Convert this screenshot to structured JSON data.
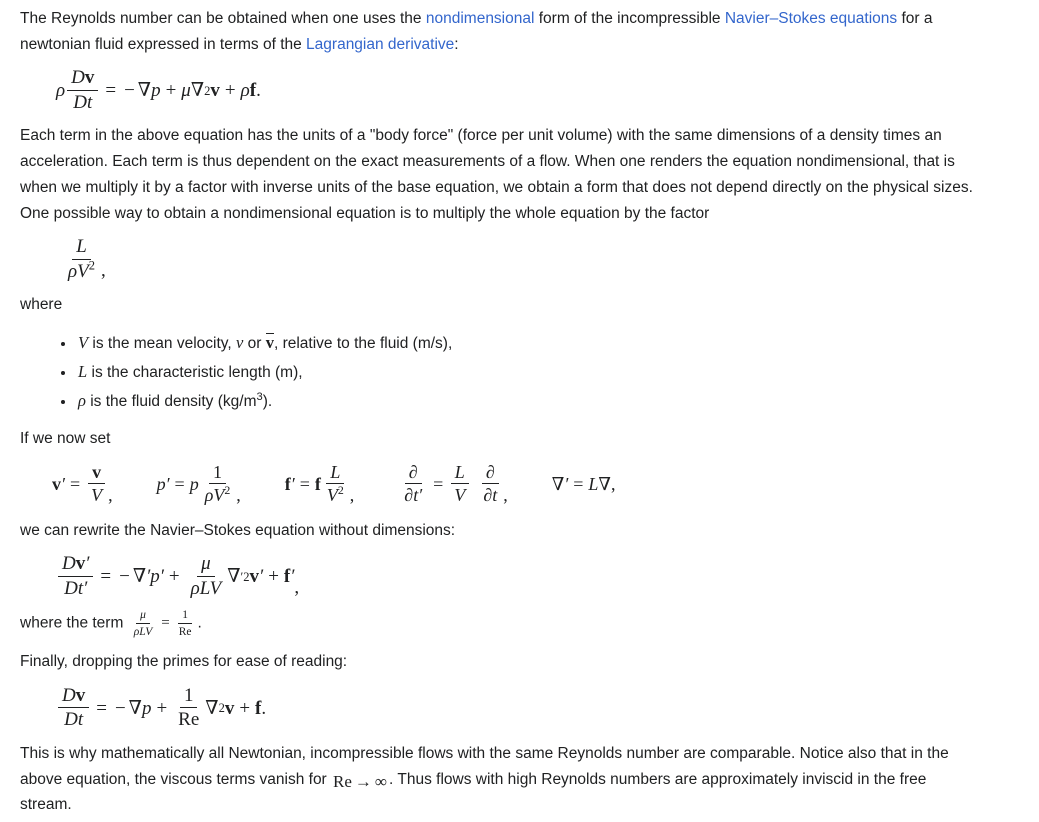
{
  "paragraphs": {
    "intro": {
      "seg1": "The Reynolds number can be obtained when one uses the ",
      "link1": "nondimensional",
      "seg2": " form of the incompressible ",
      "link2": "Navier–Stokes equations",
      "seg3": " for a newtonian fluid expressed in terms of the ",
      "link3": "Lagrangian derivative",
      "seg4": ":"
    },
    "units": "Each term in the above equation has the units of a \"body force\" (force per unit volume) with the same dimensions of a density times an acceleration. Each term is thus dependent on the exact measurements of a flow. When one renders the equation nondimensional, that is when we multiply it by a factor with inverse units of the base equation, we obtain a form that does not depend directly on the physical sizes. One possible way to obtain a nondimensional equation is to multiply the whole equation by the factor",
    "where": "where",
    "if_we_now_set": "If we now set",
    "rewrite": "we can rewrite the Navier–Stokes equation without dimensions:",
    "where_term_prefix": "where the term ",
    "where_term_suffix": ".",
    "finally": "Finally, dropping the primes for ease of reading:",
    "closing_seg1": "This is why mathematically all Newtonian, incompressible flows with the same Reynolds number are comparable. Notice also that in the above equation, the viscous terms vanish for ",
    "closing_seg2": ". Thus flows with high Reynolds numbers are approximately inviscid in the free stream."
  },
  "equations": {
    "navier_stokes": {
      "label": "ρ Dv/Dt = −∇p + μ∇²v + ρf.",
      "rho": "ρ",
      "num": "D",
      "num_bold": "v",
      "den": "D",
      "den_var": "t",
      "equals": "=",
      "minus": "−",
      "nabla": "∇",
      "p": "p",
      "plus": "+",
      "mu": "μ",
      "exp2": "2",
      "v_bold": "v",
      "rho2": "ρ",
      "f_bold": "f",
      "period": "."
    },
    "factor": {
      "label": "L / ρV²,",
      "num": "L",
      "den_rho": "ρ",
      "den_V": "V",
      "den_exp": "2",
      "comma": ","
    },
    "substitutions": {
      "label": "v′ = v/V, p′ = p·1/ρV², f′ = f·L/V², ∂/∂t′ = (L/V)(∂/∂t), ∇′ = L∇,",
      "s1": {
        "lhs_bold": "v",
        "prime": "′",
        "equals": "=",
        "num_bold": "v",
        "den": "V",
        "comma": ","
      },
      "s2": {
        "lhs": "p",
        "prime": "′",
        "equals": "=",
        "factor": "p",
        "num": "1",
        "den_rho": "ρ",
        "den_V": "V",
        "den_exp": "2",
        "comma": ","
      },
      "s3": {
        "lhs_bold": "f",
        "prime": "′",
        "equals": "=",
        "factor_bold": "f",
        "num": "L",
        "den": "V",
        "den_exp": "2",
        "comma": ","
      },
      "s4": {
        "num": "∂",
        "den_partial": "∂",
        "den_t": "t",
        "den_prime": "′",
        "equals": "=",
        "fnum": "L",
        "fden": "V",
        "pnum": "∂",
        "pden_partial": "∂",
        "pden_t": "t",
        "comma": ","
      },
      "s5": {
        "nabla": "∇",
        "prime": "′",
        "equals": "=",
        "L": "L",
        "nabla2": "∇",
        "comma": ","
      }
    },
    "nondim": {
      "label": "Dv′/Dt′ = −∇′p′ + μ/(ρLV) ∇′²v′ + f′,",
      "num_D": "D",
      "num_v": "v",
      "num_prime": "′",
      "den_D": "D",
      "den_t": "t",
      "den_prime": "′",
      "equals": "=",
      "minus": "−",
      "nabla": "∇",
      "nabla_prime": "′",
      "p": "p",
      "p_prime": "′",
      "plus": "+",
      "mu": "μ",
      "rho": "ρ",
      "L": "L",
      "V": "V",
      "nabla2": "∇",
      "nabla2_prime": "′",
      "exp2": "2",
      "v_bold": "v",
      "v_prime": "′",
      "f_bold": "f",
      "f_prime": "′",
      "comma": ","
    },
    "reynolds_term": {
      "label": "μ/ρLV = 1/Re",
      "mu": "μ",
      "rho": "ρ",
      "L": "L",
      "V": "V",
      "equals": "=",
      "one": "1",
      "Re": "Re"
    },
    "final": {
      "label": "Dv/Dt = −∇p + (1/Re)∇²v + f.",
      "num_D": "D",
      "num_v": "v",
      "den_D": "D",
      "den_t": "t",
      "equals": "=",
      "minus": "−",
      "nabla": "∇",
      "p": "p",
      "plus": "+",
      "one": "1",
      "Re": "Re",
      "nabla2": "∇",
      "exp2": "2",
      "v_bold": "v",
      "f_bold": "f",
      "period": "."
    },
    "re_limit": {
      "label": "Re → ∞",
      "Re": "Re",
      "arrow": "→",
      "infinity": "∞"
    }
  },
  "definitions": [
    {
      "symbol": "V",
      "text_before": " is the mean velocity, ",
      "alt1": "v",
      "text_mid": " or ",
      "alt2": "v",
      "text_after": ", relative to the fluid (m/s),"
    },
    {
      "symbol": "L",
      "text_before": " is the characteristic length (m),",
      "text_after": ""
    },
    {
      "symbol": "ρ",
      "text_before": " is the fluid density (kg/m",
      "sup": "3",
      "text_after": ")."
    }
  ],
  "colors": {
    "link": "#3366cc",
    "text": "#202122",
    "background": "#ffffff"
  }
}
